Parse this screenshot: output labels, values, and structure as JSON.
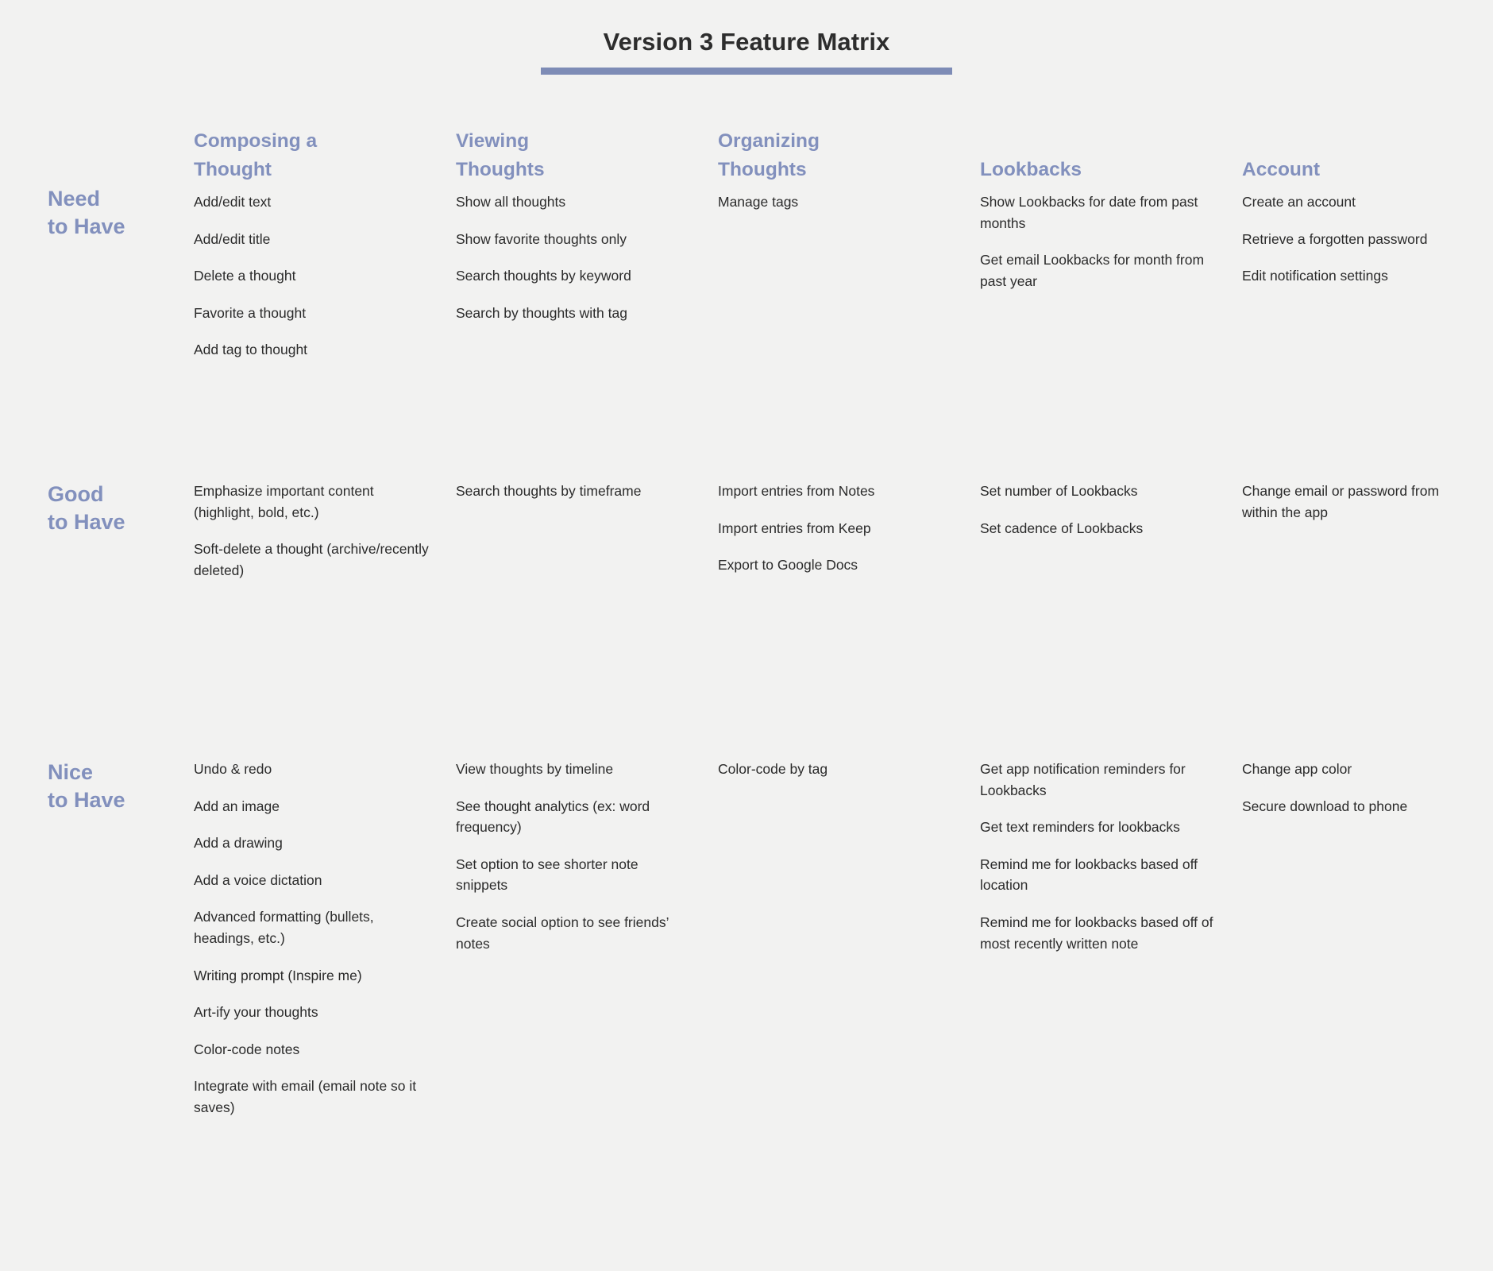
{
  "document": {
    "title": "Version 3 Feature Matrix",
    "accent_color": "#7e8cb6",
    "heading_color": "#8290bd",
    "background_color": "#f2f2f1",
    "body_text_color": "#2b2b2b"
  },
  "columns": [
    {
      "label": "Composing a\nThought"
    },
    {
      "label": "Viewing\nThoughts"
    },
    {
      "label": "Organizing\nThoughts"
    },
    {
      "label": "Lookbacks"
    },
    {
      "label": "Account"
    }
  ],
  "rows": [
    {
      "label": "Need\nto Have",
      "cells": [
        [
          "Add/edit text",
          "Add/edit title",
          "Delete a thought",
          "Favorite a thought",
          "Add tag to thought"
        ],
        [
          "Show all thoughts",
          "Show favorite thoughts only",
          "Search thoughts by keyword",
          "Search by thoughts with tag"
        ],
        [
          "Manage tags"
        ],
        [
          "Show Lookbacks for date from past months",
          "Get email Lookbacks for month from past year"
        ],
        [
          "Create an account",
          "Retrieve a forgotten password",
          "Edit notification settings"
        ]
      ]
    },
    {
      "label": "Good\nto Have",
      "cells": [
        [
          "Emphasize important content (highlight, bold, etc.)",
          "Soft-delete a thought (archive/recently deleted)"
        ],
        [
          "Search thoughts by timeframe"
        ],
        [
          "Import entries from Notes",
          "Import entries from Keep",
          "Export to Google Docs"
        ],
        [
          "Set number of Lookbacks",
          "Set cadence of Lookbacks"
        ],
        [
          "Change email or password from within the app"
        ]
      ]
    },
    {
      "label": "Nice\nto Have",
      "cells": [
        [
          "Undo & redo",
          "Add an image",
          "Add a drawing",
          "Add a voice dictation",
          "Advanced formatting (bullets, headings, etc.)",
          "Writing prompt (Inspire me)",
          "Art-ify your thoughts",
          "Color-code notes",
          "Integrate with email (email note so it saves)"
        ],
        [
          "View thoughts by timeline",
          "See thought analytics (ex: word frequency)",
          "Set option to see shorter note snippets",
          "Create social option to see friends’ notes"
        ],
        [
          "Color-code by tag"
        ],
        [
          "Get app notification reminders for Lookbacks",
          "Get text reminders for lookbacks",
          "Remind me for lookbacks based off location",
          "Remind me for lookbacks based off of most recently written note"
        ],
        [
          "Change app color",
          "Secure download to phone"
        ]
      ]
    }
  ]
}
